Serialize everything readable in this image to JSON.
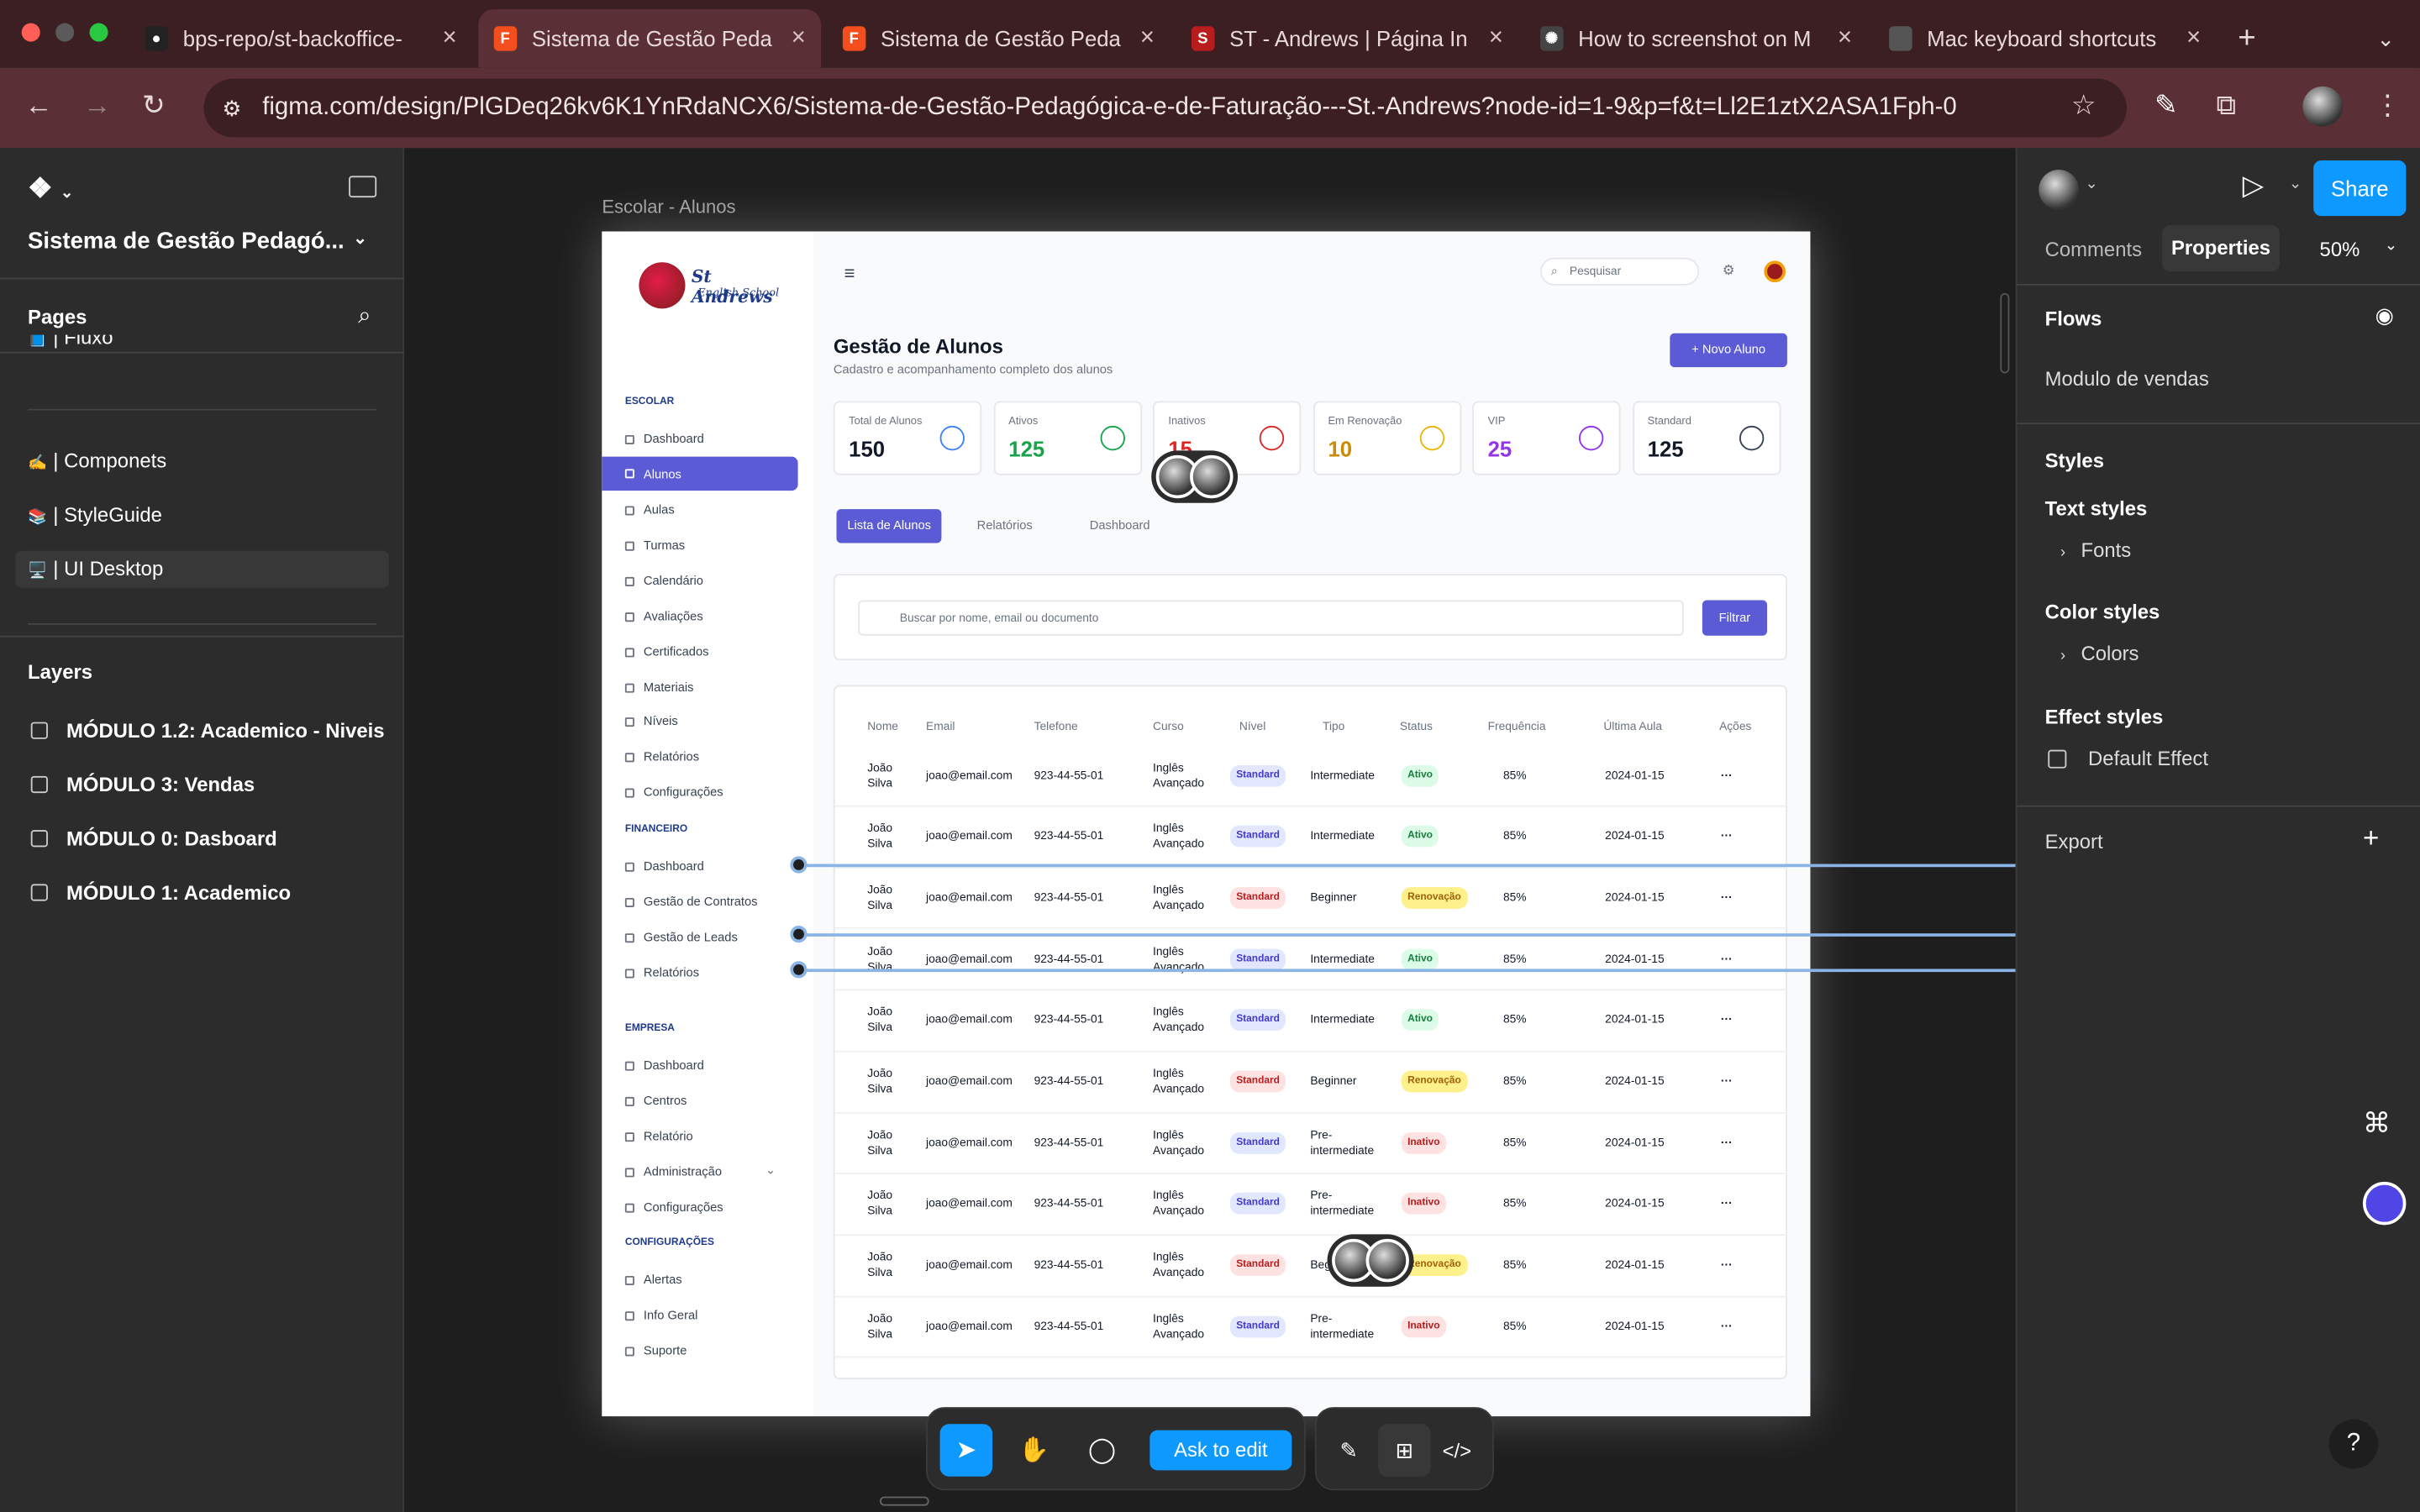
{
  "browser": {
    "tabs": [
      {
        "title": "bps-repo/st-backoffice-",
        "icon": "github-icon"
      },
      {
        "title": "Sistema de Gestão Peda",
        "icon": "figma-icon",
        "active": true
      },
      {
        "title": "Sistema de Gestão Peda",
        "icon": "figma-icon"
      },
      {
        "title": "ST - Andrews | Página In",
        "icon": "standrews-icon"
      },
      {
        "title": "How to screenshot on M",
        "icon": "openai-icon"
      },
      {
        "title": "Mac keyboard shortcuts",
        "icon": "apple-icon"
      }
    ],
    "url": "figma.com/design/PlGDeq26kv6K1YnRdaNCX6/Sistema-de-Gestão-Pedagógica-e-de-Faturação---St.-Andrews?node-id=1-9&p=f&t=Ll2E1ztX2ASA1Fph-0"
  },
  "left_panel": {
    "file_name": "Sistema de Gestão Pedagó...",
    "pages_title": "Pages",
    "pages": [
      {
        "emoji": "📘",
        "label": "| Fluxo"
      },
      {
        "emoji": "✍️",
        "label": "| Componets"
      },
      {
        "emoji": "📚",
        "label": "| StyleGuide"
      },
      {
        "emoji": "🖥️",
        "label": "| UI Desktop",
        "selected": true
      }
    ],
    "layers_title": "Layers",
    "layers": [
      "MÓDULO 1.2: Academico - Niveis",
      "MÓDULO 3: Vendas",
      "MÓDULO 0: Dasboard",
      "MÓDULO 1: Academico"
    ]
  },
  "right_panel": {
    "tab_comments": "Comments",
    "tab_properties": "Properties",
    "zoom": "50%",
    "share": "Share",
    "flows_title": "Flows",
    "flow_item": "Modulo de vendas",
    "styles_title": "Styles",
    "text_styles": "Text styles",
    "fonts": "Fonts",
    "color_styles": "Color styles",
    "colors": "Colors",
    "effect_styles": "Effect styles",
    "default_effect": "Default Effect",
    "export": "Export"
  },
  "canvas": {
    "frame_label": "Escolar - Alunos"
  },
  "app": {
    "logo_text_1": "St Andrews",
    "logo_text_2": "English School",
    "search_placeholder": "Pesquisar",
    "sections": {
      "escolar": "ESCOLAR",
      "financeiro": "FINANCEIRO",
      "empresa": "EMPRESA",
      "configuracoes": "CONFIGURAÇÕES"
    },
    "escolar_items": [
      "Dashboard",
      "Alunos",
      "Aulas",
      "Turmas",
      "Calendário",
      "Avaliações",
      "Certificados",
      "Materiais",
      "Níveis",
      "Relatórios",
      "Configurações"
    ],
    "financeiro_items": [
      "Dashboard",
      "Gestão de Contratos",
      "Gestão de Leads",
      "Relatórios"
    ],
    "empresa_items": [
      "Dashboard",
      "Centros",
      "Relatório",
      "Administração",
      "Configurações"
    ],
    "config_items": [
      "Alertas",
      "Info Geral",
      "Suporte"
    ],
    "page_title": "Gestão de Alunos",
    "page_subtitle": "Cadastro e acompanhamento completo dos alunos",
    "new_button": "Novo Aluno",
    "stats": [
      {
        "label": "Total de Alunos",
        "value": "150",
        "color": "#111827",
        "icon": "users-icon",
        "icon_color": "#3b82f6"
      },
      {
        "label": "Ativos",
        "value": "125",
        "color": "#16a34a",
        "icon": "user-check-icon",
        "icon_color": "#16a34a"
      },
      {
        "label": "Inativos",
        "value": "15",
        "color": "#dc2626",
        "icon": "user-x-icon",
        "icon_color": "#dc2626"
      },
      {
        "label": "Em Renovação",
        "value": "10",
        "color": "#ca8a04",
        "icon": "alert-circle-icon",
        "icon_color": "#eab308"
      },
      {
        "label": "VIP",
        "value": "25",
        "color": "#9333ea",
        "icon": "graduation-cap-icon",
        "icon_color": "#9333ea"
      },
      {
        "label": "Standard",
        "value": "125",
        "color": "#111827",
        "icon": "calendar-icon",
        "icon_color": "#374151"
      }
    ],
    "tabs": [
      "Lista de Alunos",
      "Relatórios",
      "Dashboard"
    ],
    "filter_placeholder": "Buscar por nome, email ou documento",
    "filter_button": "Filtrar",
    "columns": [
      "Nome",
      "Email",
      "Telefone",
      "Curso",
      "Nível",
      "Tipo",
      "Status",
      "Frequência",
      "Última Aula",
      "Ações"
    ],
    "rows": [
      {
        "nome": "João Silva",
        "email": "joao@email.com",
        "tel": "923-44-55-01",
        "curso": "Inglês Avançado",
        "nivel": "Standard",
        "nivel_red": false,
        "tipo": "Intermediate",
        "status": "Ativo",
        "freq": "85%",
        "ultima": "2024-01-15"
      },
      {
        "nome": "João Silva",
        "email": "joao@email.com",
        "tel": "923-44-55-01",
        "curso": "Inglês Avançado",
        "nivel": "Standard",
        "nivel_red": false,
        "tipo": "Intermediate",
        "status": "Ativo",
        "freq": "85%",
        "ultima": "2024-01-15"
      },
      {
        "nome": "João Silva",
        "email": "joao@email.com",
        "tel": "923-44-55-01",
        "curso": "Inglês Avançado",
        "nivel": "Standard",
        "nivel_red": true,
        "tipo": "Beginner",
        "status": "Renovação",
        "freq": "85%",
        "ultima": "2024-01-15"
      },
      {
        "nome": "João Silva",
        "email": "joao@email.com",
        "tel": "923-44-55-01",
        "curso": "Inglês Avançado",
        "nivel": "Standard",
        "nivel_red": false,
        "tipo": "Intermediate",
        "status": "Ativo",
        "freq": "85%",
        "ultima": "2024-01-15"
      },
      {
        "nome": "João Silva",
        "email": "joao@email.com",
        "tel": "923-44-55-01",
        "curso": "Inglês Avançado",
        "nivel": "Standard",
        "nivel_red": false,
        "tipo": "Intermediate",
        "status": "Ativo",
        "freq": "85%",
        "ultima": "2024-01-15"
      },
      {
        "nome": "João Silva",
        "email": "joao@email.com",
        "tel": "923-44-55-01",
        "curso": "Inglês Avançado",
        "nivel": "Standard",
        "nivel_red": true,
        "tipo": "Beginner",
        "status": "Renovação",
        "freq": "85%",
        "ultima": "2024-01-15"
      },
      {
        "nome": "João Silva",
        "email": "joao@email.com",
        "tel": "923-44-55-01",
        "curso": "Inglês Avançado",
        "nivel": "Standard",
        "nivel_red": false,
        "tipo": "Pre-intermediate",
        "status": "Inativo",
        "freq": "85%",
        "ultima": "2024-01-15"
      },
      {
        "nome": "João Silva",
        "email": "joao@email.com",
        "tel": "923-44-55-01",
        "curso": "Inglês Avançado",
        "nivel": "Standard",
        "nivel_red": false,
        "tipo": "Pre-intermediate",
        "status": "Inativo",
        "freq": "85%",
        "ultima": "2024-01-15"
      },
      {
        "nome": "João Silva",
        "email": "joao@email.com",
        "tel": "923-44-55-01",
        "curso": "Inglês Avançado",
        "nivel": "Standard",
        "nivel_red": true,
        "tipo": "Beginner",
        "status": "Renovação",
        "freq": "85%",
        "ultima": "2024-01-15"
      },
      {
        "nome": "João Silva",
        "email": "joao@email.com",
        "tel": "923-44-55-01",
        "curso": "Inglês Avançado",
        "nivel": "Standard",
        "nivel_red": false,
        "tipo": "Pre-intermediate",
        "status": "Inativo",
        "freq": "85%",
        "ultima": "2024-01-15"
      }
    ],
    "actions_glyph": "···"
  },
  "toolbar": {
    "ask_to_edit": "Ask to edit"
  },
  "colors": {
    "accent": "#5b5bd6",
    "figma_blue": "#0d99ff",
    "tab_bg": "#3c1f23"
  }
}
